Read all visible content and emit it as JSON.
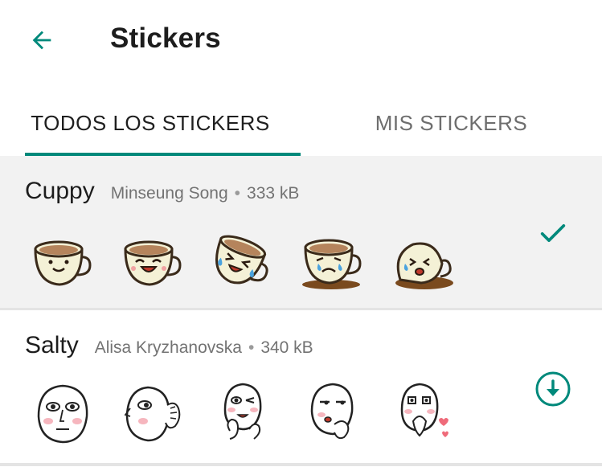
{
  "header": {
    "title": "Stickers",
    "back_icon": "arrow-back-icon"
  },
  "tabs": [
    {
      "label": "TODOS LOS STICKERS",
      "active": true
    },
    {
      "label": "MIS STICKERS",
      "active": false
    }
  ],
  "packs": [
    {
      "name": "Cuppy",
      "author": "Minseung Song",
      "size": "333 kB",
      "status": "installed",
      "status_icon": "check-icon",
      "stickers": [
        "cup-smile",
        "cup-laugh",
        "cup-tears-of-joy",
        "cup-crying",
        "cup-spilled-crying"
      ]
    },
    {
      "name": "Salty",
      "author": "Alisa Kryzhanovska",
      "size": "340 kB",
      "status": "not-installed",
      "status_icon": "download-icon",
      "stickers": [
        "face-neutral",
        "face-side-wave",
        "face-wink-thumbs",
        "face-smirk",
        "face-blowing-kisses"
      ]
    }
  ],
  "colors": {
    "accent": "#00897b",
    "tab_inactive": "#6e6e6e",
    "meta_text": "#737373",
    "selected_bg": "#f2f2f2"
  }
}
